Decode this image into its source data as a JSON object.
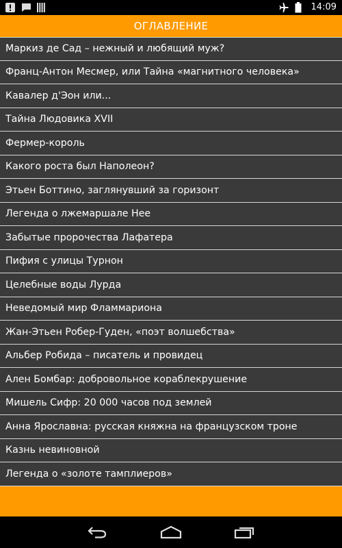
{
  "status_bar": {
    "time": "14:09",
    "left_icons": [
      "alert-icon",
      "chat-icon",
      "signal-bars-icon"
    ],
    "right_icons": [
      "airplane-mode-icon",
      "battery-icon"
    ]
  },
  "header": {
    "title": "ОГЛАВЛЕНИЕ"
  },
  "toc": {
    "items": [
      "Маркиз де Сад – нежный и любящий муж?",
      "Франц-Антон Месмер, или Тайна «магнитного человека»",
      "Кавалер д'Эон или...",
      "Тайна Людовика XVII",
      "Фермер-король",
      "Какого роста был Наполеон?",
      "Этьен Боттино, заглянувший за горизонт",
      "Легенда о лжемаршале Нее",
      "Забытые пророчества Лафатера",
      "Пифия с улицы Турнон",
      "Целебные воды Лурда",
      "Неведомый мир Фламмариона",
      "Жан-Этьен Робер-Гуден, «поэт волшебства»",
      "Альбер Робида – писатель и провидец",
      "Ален Бомбар: добровольное кораблекрушение",
      "Мишель Сифр: 20 000 часов под землей",
      "Анна Ярославна: русская княжна на французском троне",
      "Казнь невиновной",
      "Легенда о «золоте тамплиеров»"
    ]
  },
  "nav_bar": {
    "buttons": [
      "back-icon",
      "home-icon",
      "recent-apps-icon"
    ]
  },
  "colors": {
    "accent": "#FF9A00",
    "list_background": "#3A3A3A",
    "divider": "#D8D8D8"
  }
}
